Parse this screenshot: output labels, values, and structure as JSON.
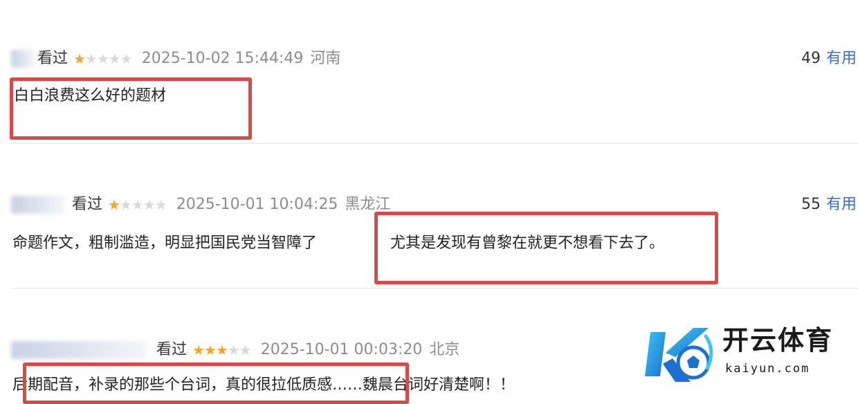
{
  "reviews": [
    {
      "status": "看过",
      "rating": 1,
      "max_rating": 5,
      "time": "2025-10-02 15:44:49",
      "location": "河南",
      "votes": "49",
      "vote_label": "有用",
      "content": "白白浪费这么好的题材",
      "content_tail": ""
    },
    {
      "status": "看过",
      "rating": 1,
      "max_rating": 5,
      "time": "2025-10-01 10:04:25",
      "location": "黑龙江",
      "votes": "55",
      "vote_label": "有用",
      "content": "命题作文，粗制滥造，明显把国民党当智障了",
      "content_tail": "尤其是发现有曾黎在就更不想看下去了。"
    },
    {
      "status": "看过",
      "rating": 3,
      "max_rating": 5,
      "time": "2025-10-01 00:03:20",
      "location": "北京",
      "votes": "",
      "vote_label": "",
      "content": "后期配音，补录的那些个台词，真的很拉低质感……魏晨台词好清楚啊！！",
      "content_tail": ""
    }
  ],
  "watermark": {
    "title": "开云体育",
    "url": "kaiyun.com"
  },
  "colors": {
    "highlight": "#d94a46",
    "star_on": "#f5a623",
    "star_off": "#d9d9d9",
    "link": "#3a70c4"
  }
}
